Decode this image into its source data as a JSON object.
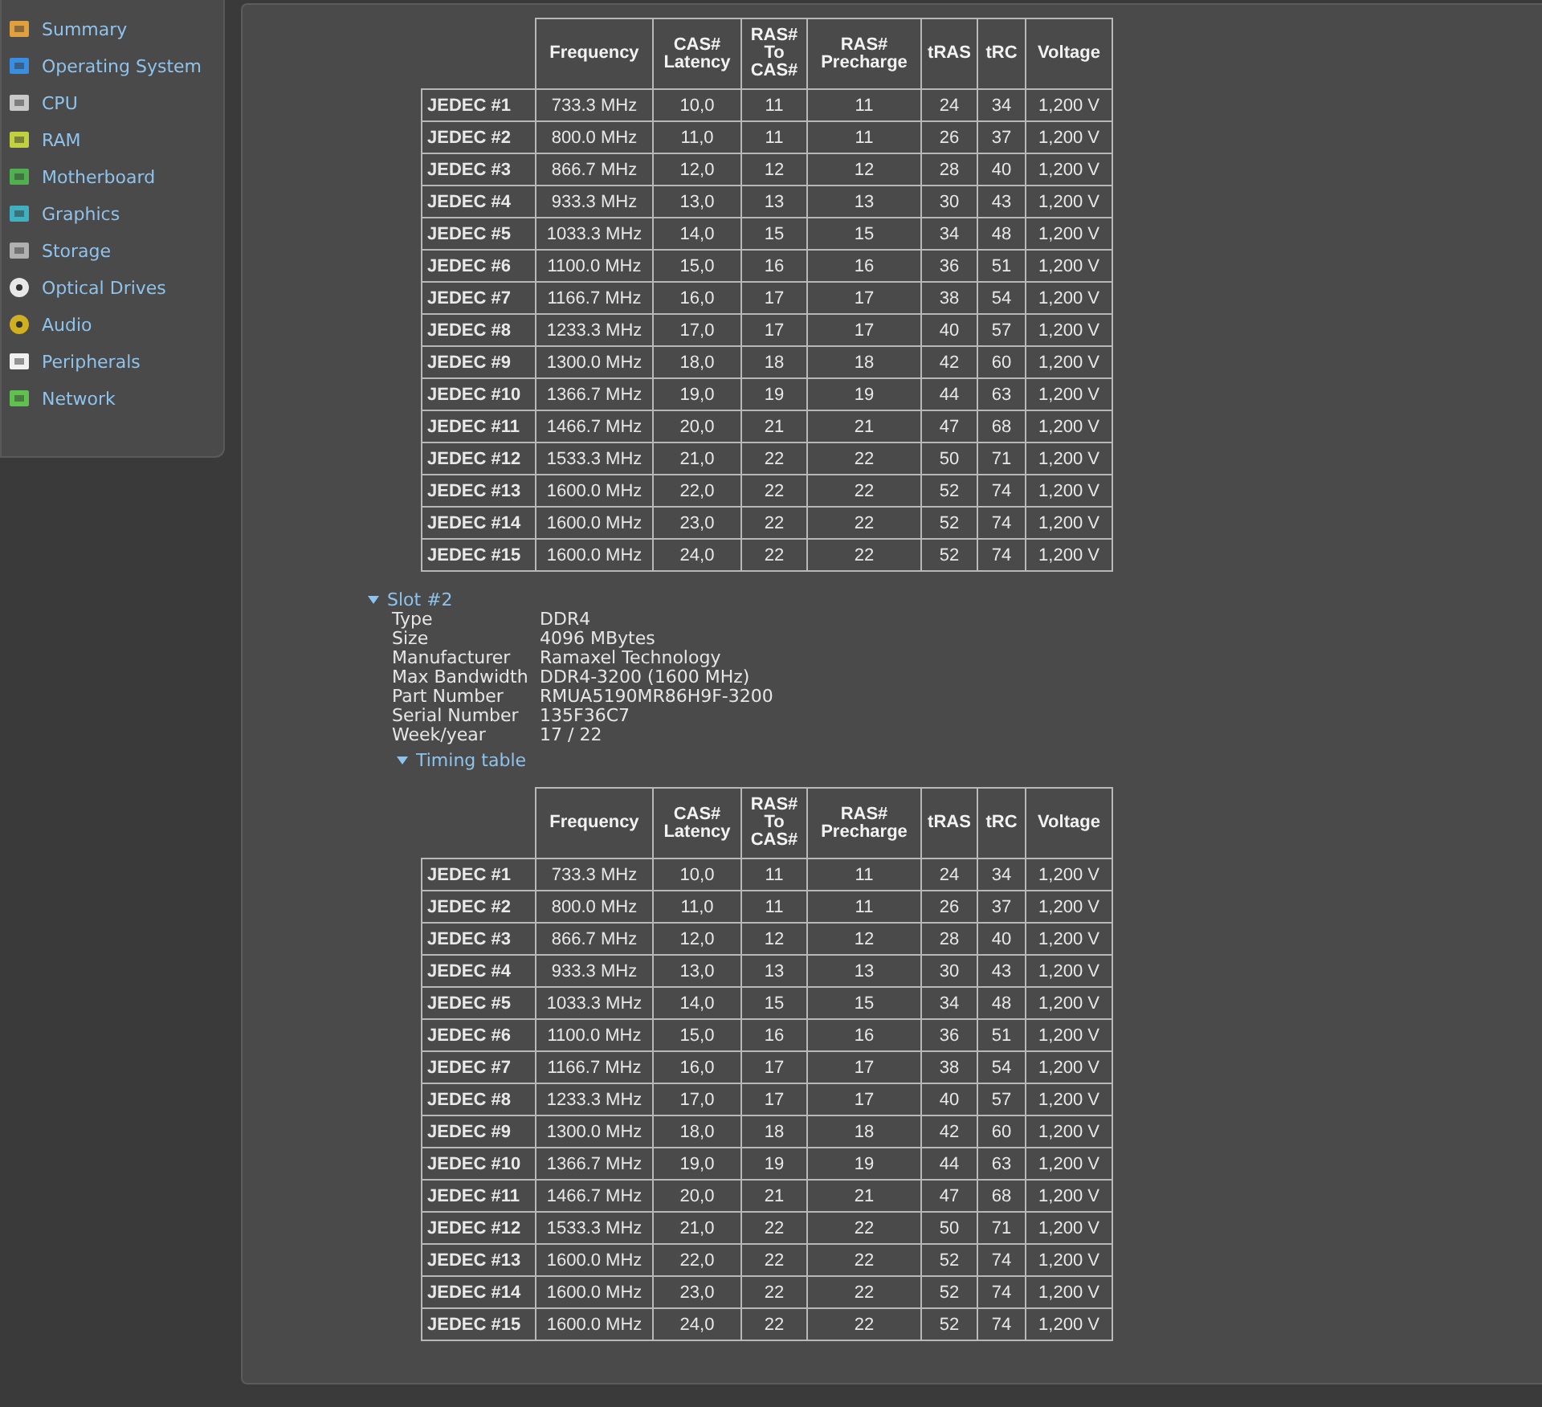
{
  "sidebar": {
    "items": [
      {
        "label": "Summary"
      },
      {
        "label": "Operating System"
      },
      {
        "label": "CPU"
      },
      {
        "label": "RAM"
      },
      {
        "label": "Motherboard"
      },
      {
        "label": "Graphics"
      },
      {
        "label": "Storage"
      },
      {
        "label": "Optical Drives"
      },
      {
        "label": "Audio"
      },
      {
        "label": "Peripherals"
      },
      {
        "label": "Network"
      }
    ]
  },
  "sections": [
    {
      "kind": "table",
      "columns": [
        "",
        "Frequency",
        "CAS# Latency",
        "RAS# To CAS#",
        "RAS# Precharge",
        "tRAS",
        "tRC",
        "Voltage"
      ],
      "rows": [
        [
          "JEDEC #1",
          "733.3 MHz",
          "10,0",
          "11",
          "11",
          "24",
          "34",
          "1,200 V"
        ],
        [
          "JEDEC #2",
          "800.0 MHz",
          "11,0",
          "11",
          "11",
          "26",
          "37",
          "1,200 V"
        ],
        [
          "JEDEC #3",
          "866.7 MHz",
          "12,0",
          "12",
          "12",
          "28",
          "40",
          "1,200 V"
        ],
        [
          "JEDEC #4",
          "933.3 MHz",
          "13,0",
          "13",
          "13",
          "30",
          "43",
          "1,200 V"
        ],
        [
          "JEDEC #5",
          "1033.3 MHz",
          "14,0",
          "15",
          "15",
          "34",
          "48",
          "1,200 V"
        ],
        [
          "JEDEC #6",
          "1100.0 MHz",
          "15,0",
          "16",
          "16",
          "36",
          "51",
          "1,200 V"
        ],
        [
          "JEDEC #7",
          "1166.7 MHz",
          "16,0",
          "17",
          "17",
          "38",
          "54",
          "1,200 V"
        ],
        [
          "JEDEC #8",
          "1233.3 MHz",
          "17,0",
          "17",
          "17",
          "40",
          "57",
          "1,200 V"
        ],
        [
          "JEDEC #9",
          "1300.0 MHz",
          "18,0",
          "18",
          "18",
          "42",
          "60",
          "1,200 V"
        ],
        [
          "JEDEC #10",
          "1366.7 MHz",
          "19,0",
          "19",
          "19",
          "44",
          "63",
          "1,200 V"
        ],
        [
          "JEDEC #11",
          "1466.7 MHz",
          "20,0",
          "21",
          "21",
          "47",
          "68",
          "1,200 V"
        ],
        [
          "JEDEC #12",
          "1533.3 MHz",
          "21,0",
          "22",
          "22",
          "50",
          "71",
          "1,200 V"
        ],
        [
          "JEDEC #13",
          "1600.0 MHz",
          "22,0",
          "22",
          "22",
          "52",
          "74",
          "1,200 V"
        ],
        [
          "JEDEC #14",
          "1600.0 MHz",
          "23,0",
          "22",
          "22",
          "52",
          "74",
          "1,200 V"
        ],
        [
          "JEDEC #15",
          "1600.0 MHz",
          "24,0",
          "22",
          "22",
          "52",
          "74",
          "1,200 V"
        ]
      ]
    },
    {
      "kind": "slot",
      "title": "Slot #2",
      "expanded": true,
      "properties": [
        {
          "name": "Type",
          "value": "DDR4"
        },
        {
          "name": "Size",
          "value": "4096 MBytes"
        },
        {
          "name": "Manufacturer",
          "value": "Ramaxel Technology"
        },
        {
          "name": "Max Bandwidth",
          "value": "DDR4-3200 (1600 MHz)"
        },
        {
          "name": "Part Number",
          "value": "RMUA5190MR86H9F-3200"
        },
        {
          "name": "Serial Number",
          "value": "135F36C7"
        },
        {
          "name": "Week/year",
          "value": "17 / 22"
        }
      ],
      "subsection": {
        "title": "Timing table",
        "expanded": true
      }
    },
    {
      "kind": "table",
      "columns": [
        "",
        "Frequency",
        "CAS# Latency",
        "RAS# To CAS#",
        "RAS# Precharge",
        "tRAS",
        "tRC",
        "Voltage"
      ],
      "rows": [
        [
          "JEDEC #1",
          "733.3 MHz",
          "10,0",
          "11",
          "11",
          "24",
          "34",
          "1,200 V"
        ],
        [
          "JEDEC #2",
          "800.0 MHz",
          "11,0",
          "11",
          "11",
          "26",
          "37",
          "1,200 V"
        ],
        [
          "JEDEC #3",
          "866.7 MHz",
          "12,0",
          "12",
          "12",
          "28",
          "40",
          "1,200 V"
        ],
        [
          "JEDEC #4",
          "933.3 MHz",
          "13,0",
          "13",
          "13",
          "30",
          "43",
          "1,200 V"
        ],
        [
          "JEDEC #5",
          "1033.3 MHz",
          "14,0",
          "15",
          "15",
          "34",
          "48",
          "1,200 V"
        ],
        [
          "JEDEC #6",
          "1100.0 MHz",
          "15,0",
          "16",
          "16",
          "36",
          "51",
          "1,200 V"
        ],
        [
          "JEDEC #7",
          "1166.7 MHz",
          "16,0",
          "17",
          "17",
          "38",
          "54",
          "1,200 V"
        ],
        [
          "JEDEC #8",
          "1233.3 MHz",
          "17,0",
          "17",
          "17",
          "40",
          "57",
          "1,200 V"
        ],
        [
          "JEDEC #9",
          "1300.0 MHz",
          "18,0",
          "18",
          "18",
          "42",
          "60",
          "1,200 V"
        ],
        [
          "JEDEC #10",
          "1366.7 MHz",
          "19,0",
          "19",
          "19",
          "44",
          "63",
          "1,200 V"
        ],
        [
          "JEDEC #11",
          "1466.7 MHz",
          "20,0",
          "21",
          "21",
          "47",
          "68",
          "1,200 V"
        ],
        [
          "JEDEC #12",
          "1533.3 MHz",
          "21,0",
          "22",
          "22",
          "50",
          "71",
          "1,200 V"
        ],
        [
          "JEDEC #13",
          "1600.0 MHz",
          "22,0",
          "22",
          "22",
          "52",
          "74",
          "1,200 V"
        ],
        [
          "JEDEC #14",
          "1600.0 MHz",
          "23,0",
          "22",
          "22",
          "52",
          "74",
          "1,200 V"
        ],
        [
          "JEDEC #15",
          "1600.0 MHz",
          "24,0",
          "22",
          "22",
          "52",
          "74",
          "1,200 V"
        ]
      ]
    }
  ]
}
